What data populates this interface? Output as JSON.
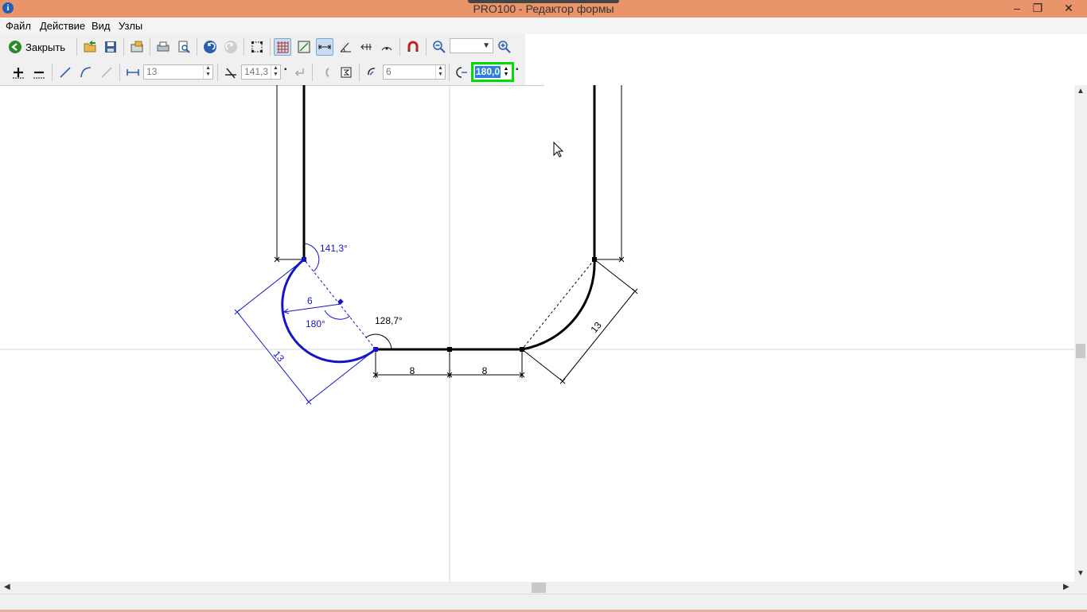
{
  "window": {
    "title": "PRO100 - Редактор формы",
    "app_icon": "i",
    "buttons": {
      "minimize": "–",
      "restore": "❐",
      "close": "✕"
    }
  },
  "menu": [
    "Файл",
    "Действие",
    "Вид",
    "Узлы"
  ],
  "toolbar1": {
    "close_label": "Закрыть",
    "icons": [
      "open-icon",
      "save-icon",
      "export-icon",
      "print-icon",
      "print-preview-icon",
      "undo-icon",
      "redo-icon",
      "select-nodes-icon",
      "grid-icon",
      "snap-grid-icon",
      "dimension-toggle-icon",
      "angle-toggle-icon",
      "align-icon",
      "arc-center-icon",
      "magnet-icon",
      "zoom-out-icon",
      "zoom-in-icon"
    ],
    "zoom_value": ""
  },
  "toolbar2": {
    "length_value": "13",
    "angle_value": "141,3",
    "radius_value": "6",
    "arc_angle_value": "180,0"
  },
  "drawing": {
    "labels": {
      "angle_top": "141,3°",
      "radius": "6",
      "arc_angle": "180°",
      "angle_bottom": "128,7°",
      "chord_left": "13",
      "chord_right": "13",
      "seg_left": "8",
      "seg_right": "8"
    },
    "colors": {
      "shape": "#000000",
      "selected": "#1414c8",
      "dim": "#0000cc",
      "guide": "#d0d0d0"
    }
  }
}
